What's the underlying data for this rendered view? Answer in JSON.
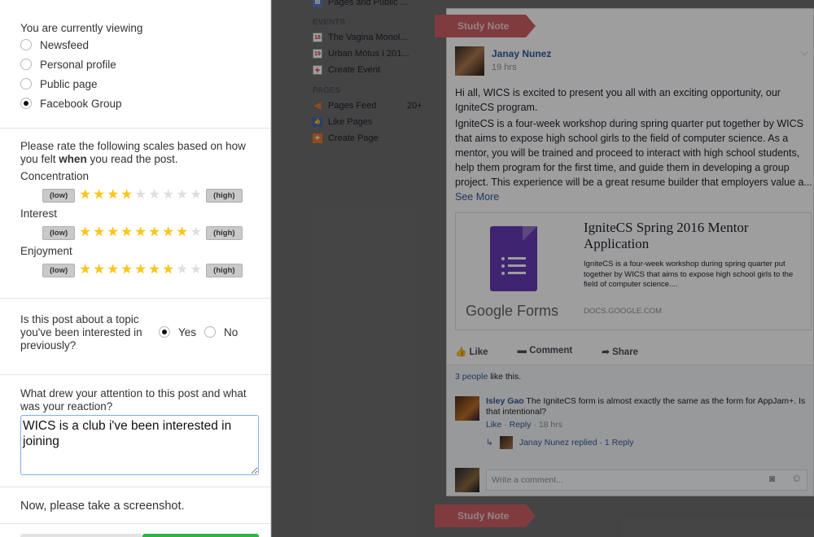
{
  "survey": {
    "viewing": {
      "question": "You are currently viewing",
      "options": [
        "Newsfeed",
        "Personal profile",
        "Public page",
        "Facebook Group"
      ],
      "selected": 3
    },
    "rating": {
      "question_pre": "Please rate the following scales based on how you felt ",
      "question_bold": "when",
      "question_post": " you read the post.",
      "low_label": "(low)",
      "high_label": "(high)",
      "max_stars": 9,
      "scales": [
        {
          "name": "Concentration",
          "value": 4
        },
        {
          "name": "Interest",
          "value": 8
        },
        {
          "name": "Enjoyment",
          "value": 7
        }
      ]
    },
    "topic": {
      "question": "Is this post about a topic you've been interested in previously?",
      "yes_label": "Yes",
      "no_label": "No",
      "selected": "Yes"
    },
    "attention": {
      "question": "What drew your attention to this post and what was your reaction?",
      "answer": "WICS is a club i've been interested in joining"
    },
    "screenshot_prompt": "Now, please take a screenshot."
  },
  "fb_sidebar": {
    "top_item": "Pages and Public ...",
    "events_header": "EVENTS",
    "events": [
      {
        "day": "18",
        "label": "The Vagina Monol..."
      },
      {
        "day": "19",
        "label": "Urban Mótus I 201..."
      }
    ],
    "create_event": "Create Event",
    "pages_header": "PAGES",
    "pages_feed": "Pages Feed",
    "pages_feed_count": "20+",
    "like_pages": "Like Pages",
    "create_page": "Create Page"
  },
  "post": {
    "ribbon": "Study Note",
    "author": "Janay Nunez",
    "time": "19 hrs",
    "para1": "Hi all, WICS is excited to present you all with an exciting opportunity, our IgniteCS program.",
    "para2": "IgniteCS is a four-week workshop during spring quarter put together by WICS that aims to expose high school girls to the field of computer science. As a mentor, you will be trained and proceed to interact with high school students, help them program for the first time, and guide them in developing a group project. This experience will be a great resume builder that employers value a...",
    "see_more": "See More",
    "link_title": "IgniteCS Spring 2016 Mentor Application",
    "link_desc": "IgniteCS is a four-week workshop during spring quarter put together by WICS that aims to expose high school girls to the field of computer science....",
    "link_domain": "DOCS.GOOGLE.COM",
    "forms_label": "Google Forms",
    "like": "Like",
    "comment": "Comment",
    "share": "Share",
    "likes_count": "3 people",
    "likes_suffix": " like this.",
    "comment_author": "Isley Gao",
    "comment_text": " The IgniteCS form is almost exactly the same as the form for AppJam+. Is that intentional?",
    "comment_like": "Like",
    "comment_reply": "Reply",
    "comment_time": "18 hrs",
    "reply_text": "Janay Nunez replied · 1 Reply",
    "write_placeholder": "Write a comment...",
    "ribbon2": "Study Note"
  }
}
